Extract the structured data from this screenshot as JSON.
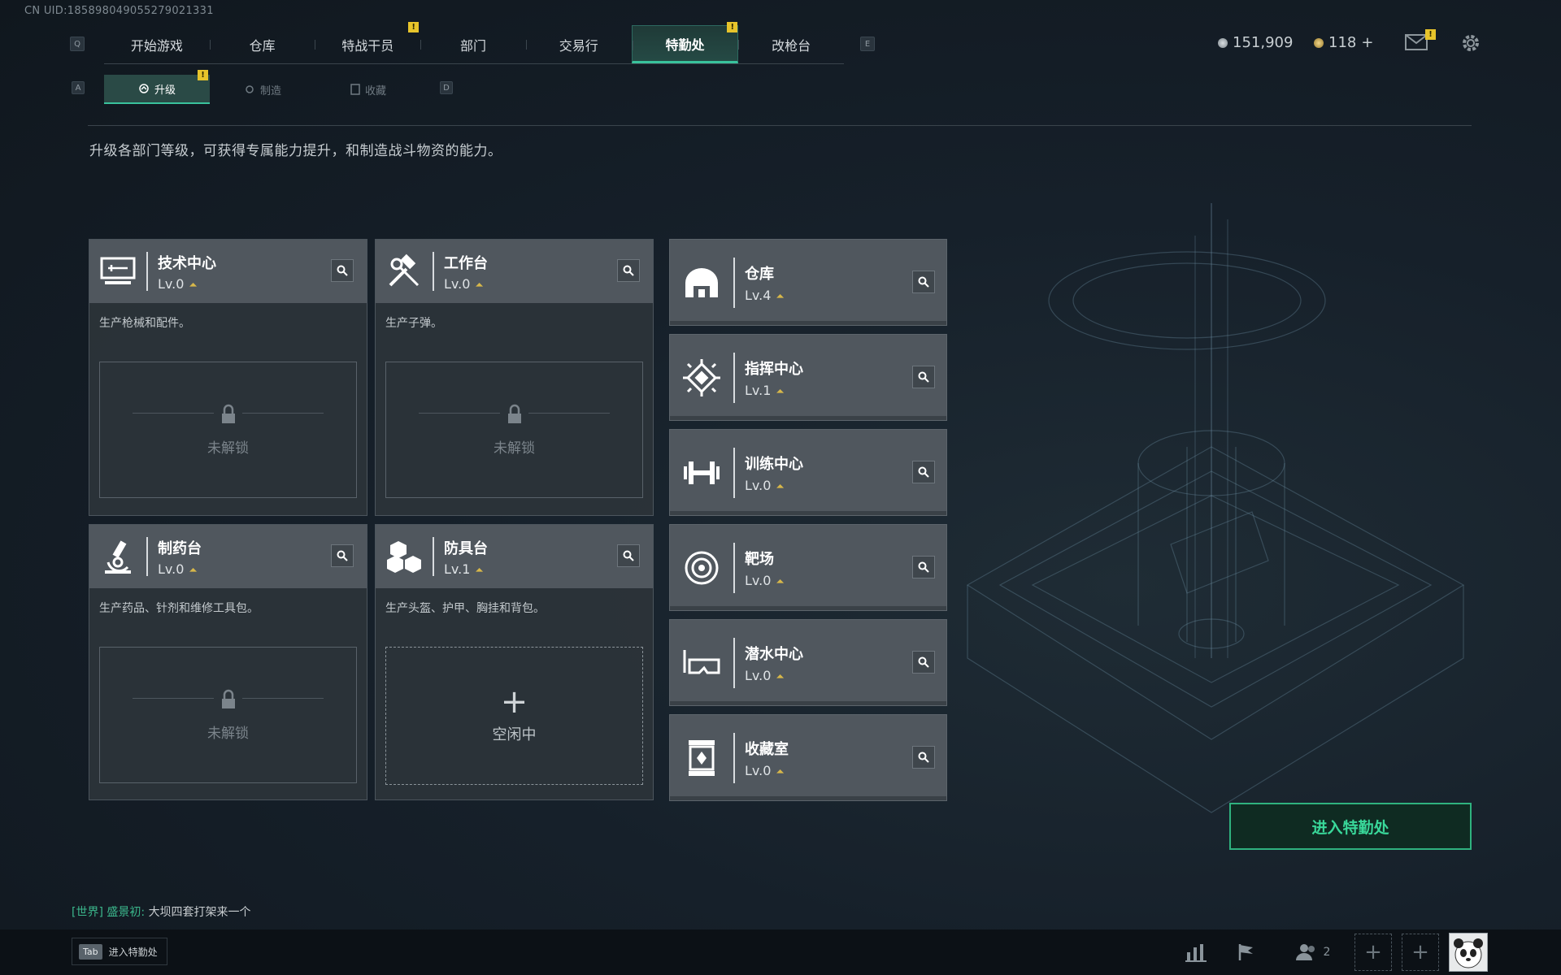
{
  "uid": "CN UID:1858980490552790213​31",
  "key_hints": {
    "prev_tab": "Q",
    "next_tab": "E",
    "prev_sub": "A",
    "next_sub": "D"
  },
  "top_nav": {
    "tabs": [
      {
        "label": "开始游戏"
      },
      {
        "label": "仓库"
      },
      {
        "label": "特战干员",
        "alert": "!"
      },
      {
        "label": "部门"
      },
      {
        "label": "交易行"
      },
      {
        "label": "特勤处",
        "alert": "!",
        "active": true
      },
      {
        "label": "改枪台"
      }
    ]
  },
  "sub_nav": {
    "tabs": [
      {
        "label": "升级",
        "active": true,
        "alert": "!"
      },
      {
        "label": "制造"
      },
      {
        "label": "收藏"
      }
    ]
  },
  "currency": {
    "coins": "151,909",
    "bonds": "118",
    "bonds_add": "+"
  },
  "mail_alert": "!",
  "description": "升级各部门等级，可获得专属能力提升，和制造战斗物资的能力。",
  "level_prefix": "Lv.",
  "production_cards": [
    {
      "name": "技术中心",
      "level": "Lv.0",
      "desc": "生产枪械和配件。",
      "status": "未解锁",
      "icon": "computer-terminal-icon"
    },
    {
      "name": "工作台",
      "level": "Lv.0",
      "desc": "生产子弹。",
      "status": "未解锁",
      "icon": "hammer-wrench-icon"
    },
    {
      "name": "制药台",
      "level": "Lv.0",
      "desc": "生产药品、针剂和维修工具包。",
      "status": "未解锁",
      "icon": "microscope-icon"
    },
    {
      "name": "防具台",
      "level": "Lv.1",
      "desc": "生产头盔、护甲、胸挂和背包。",
      "status": "空闲中",
      "icon": "cubes-icon"
    }
  ],
  "facilities": [
    {
      "name": "仓库",
      "level": "Lv.4",
      "icon": "vault-icon"
    },
    {
      "name": "指挥中心",
      "level": "Lv.1",
      "icon": "command-emblem-icon"
    },
    {
      "name": "训练中心",
      "level": "Lv.0",
      "icon": "dumbbell-icon"
    },
    {
      "name": "靶场",
      "level": "Lv.0",
      "icon": "target-icon"
    },
    {
      "name": "潜水中心",
      "level": "Lv.0",
      "icon": "diving-mask-icon"
    },
    {
      "name": "收藏室",
      "level": "Lv.0",
      "icon": "display-case-icon"
    }
  ],
  "enter_button": "进入特勤处",
  "chat": {
    "channel": "[世界]",
    "sender": "盛景初:",
    "message": "大坝四套打架来一个"
  },
  "bottom": {
    "tab_key": "Tab",
    "tab_label": "进入特勤处",
    "friends_count": "2"
  },
  "colors": {
    "accent": "#39c29c",
    "alert": "#e7c42b",
    "upgrade_arrow": "#d8b84a"
  }
}
